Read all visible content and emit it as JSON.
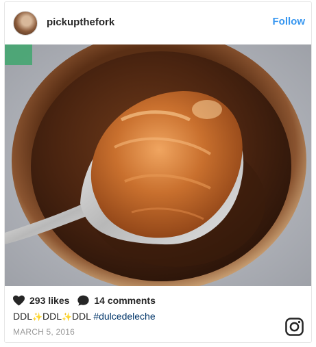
{
  "post": {
    "username": "pickupthefork",
    "follow_label": "Follow",
    "likes": "293 likes",
    "comments": "14 comments",
    "caption": {
      "part1": "DDL",
      "sparkle1": "✨",
      "part2": "DDL",
      "sparkle2": "✨",
      "part3": "DDL ",
      "hashtag": "#dulcedeleche"
    },
    "date": "MARCH 5, 2016"
  },
  "icons": {
    "heart": "heart-icon",
    "comment": "comment-bubble-icon",
    "logo": "instagram-logo-icon"
  },
  "colors": {
    "follow": "#3897f0",
    "hashtag": "#003569",
    "date": "#999999",
    "sparkle": "#f5b800"
  }
}
